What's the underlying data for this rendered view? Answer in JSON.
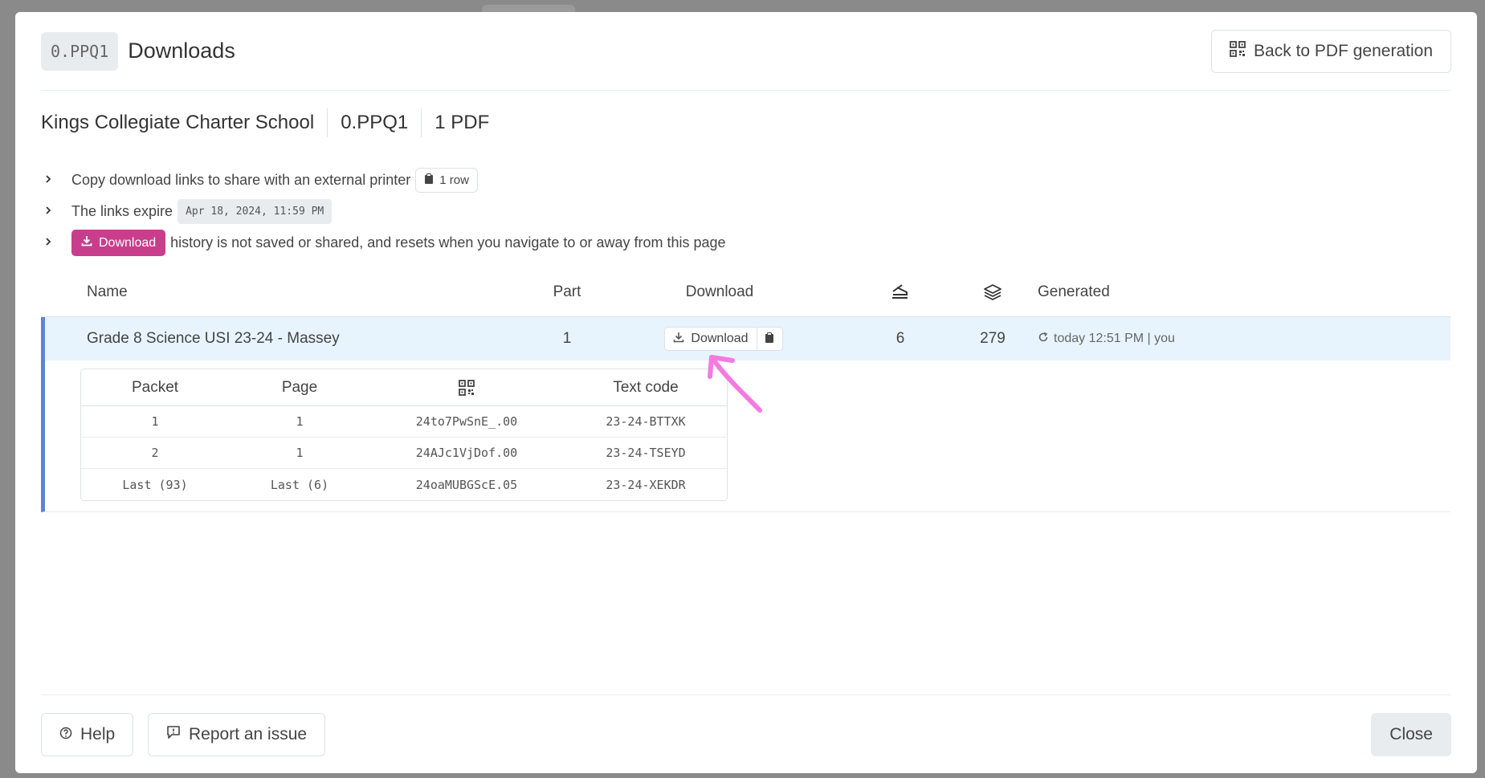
{
  "header": {
    "code": "0.PPQ1",
    "title": "Downloads",
    "back_button": "Back to PDF generation"
  },
  "meta": {
    "school": "Kings Collegiate Charter School",
    "code": "0.PPQ1",
    "pdf_count": "1 PDF"
  },
  "info": {
    "copy_text": "Copy download links to share with an external printer",
    "copy_rows": "1 row",
    "expire_text": "The links expire",
    "expire_date": "Apr 18, 2024, 11:59 PM",
    "download_label": "Download",
    "history_text": "history is not saved or shared, and resets when you navigate to or away from this page"
  },
  "table": {
    "headers": {
      "name": "Name",
      "part": "Part",
      "download": "Download",
      "staple_icon": "staple-icon",
      "layers_icon": "layers-icon",
      "generated": "Generated"
    },
    "row": {
      "name": "Grade 8 Science USI 23-24 - Massey",
      "part": "1",
      "download_label": "Download",
      "staple_count": "6",
      "page_count": "279",
      "generated": "today 12:51 PM | you"
    }
  },
  "detail": {
    "headers": {
      "packet": "Packet",
      "page": "Page",
      "qr_icon": "qr-code-icon",
      "text_code": "Text code"
    },
    "rows": [
      {
        "packet": "1",
        "page": "1",
        "qr": "24to7PwSnE_.00",
        "text_code": "23-24-BTTXK"
      },
      {
        "packet": "2",
        "page": "1",
        "qr": "24AJc1VjDof.00",
        "text_code": "23-24-TSEYD"
      },
      {
        "packet": "Last (93)",
        "page": "Last (6)",
        "qr": "24oaMUBGScE.05",
        "text_code": "23-24-XEKDR"
      }
    ]
  },
  "footer": {
    "help": "Help",
    "report": "Report an issue",
    "close": "Close"
  },
  "colors": {
    "accent_pink": "#c83e8c",
    "row_highlight": "#e7f4fd",
    "row_border": "#5b86d6",
    "annotation_arrow": "#f47ae0"
  }
}
